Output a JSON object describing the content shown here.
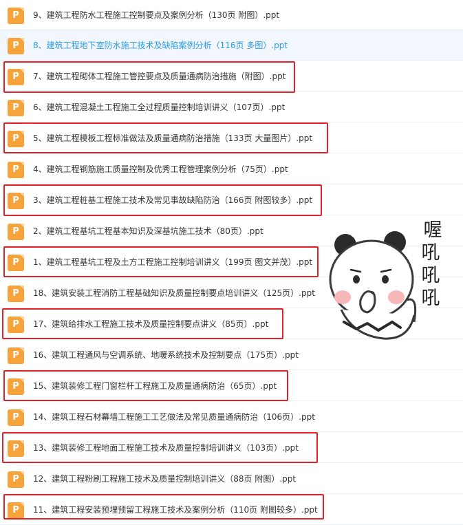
{
  "files": [
    {
      "name": "9、建筑工程防水工程施工控制要点及案例分析（130页 附图）.ppt",
      "icon": "P",
      "highlighted": false,
      "active": false
    },
    {
      "name": "8、建筑工程地下室防水施工技术及缺陷案例分析（116页 多图）.ppt",
      "icon": "P",
      "highlighted": false,
      "active": true
    },
    {
      "name": "7、建筑工程砌体工程施工管控要点及质量通病防治措施（附图）.ppt",
      "icon": "P",
      "highlighted": true,
      "active": false
    },
    {
      "name": "6、建筑工程混凝土工程施工全过程质量控制培训讲义（107页）.ppt",
      "icon": "P",
      "highlighted": false,
      "active": false
    },
    {
      "name": "5、建筑工程模板工程标准做法及质量通病防治措施（133页 大量图片）.ppt",
      "icon": "P",
      "highlighted": true,
      "active": false
    },
    {
      "name": "4、建筑工程钢筋施工质量控制及优秀工程管理案例分析（75页）.ppt",
      "icon": "P",
      "highlighted": false,
      "active": false
    },
    {
      "name": "3、建筑工程桩基工程施工技术及常见事故缺陷防治（166页 附图较多）.ppt",
      "icon": "P",
      "highlighted": true,
      "active": false
    },
    {
      "name": "2、建筑工程基坑工程基本知识及深基坑施工技术（80页）.ppt",
      "icon": "P",
      "highlighted": false,
      "active": false
    },
    {
      "name": "1、建筑工程基坑工程及土方工程施工控制培训讲义（199页 图文并茂）.ppt",
      "icon": "P",
      "highlighted": true,
      "active": false
    },
    {
      "name": "18、建筑安装工程消防工程基础知识及质量控制要点培训讲义（125页）.ppt",
      "icon": "P",
      "highlighted": false,
      "active": false
    },
    {
      "name": "17、建筑给排水工程施工技术及质量控制要点讲义（85页）.ppt",
      "icon": "P",
      "highlighted": true,
      "active": false
    },
    {
      "name": "16、建筑工程通风与空调系统、地暖系统技术及控制要点（175页）.ppt",
      "icon": "P",
      "highlighted": false,
      "active": false
    },
    {
      "name": "15、建筑装修工程门窗栏杆工程施工及质量通病防治（65页）.ppt",
      "icon": "P",
      "highlighted": true,
      "active": false
    },
    {
      "name": "14、建筑工程石材幕墙工程施工工艺做法及常见质量通病防治（106页）.ppt",
      "icon": "P",
      "highlighted": false,
      "active": false
    },
    {
      "name": "13、建筑装修工程地面工程施工技术及质量控制培训讲义（103页）.ppt",
      "icon": "P",
      "highlighted": true,
      "active": false
    },
    {
      "name": "12、建筑工程粉刷工程施工技术及质量控制培训讲义（88页 附图）.ppt",
      "icon": "P",
      "highlighted": false,
      "active": false
    },
    {
      "name": "11、建筑工程安装预埋预留工程施工技术及案例分析（110页 附图较多）.ppt",
      "icon": "P",
      "highlighted": true,
      "active": false
    }
  ],
  "sticker": {
    "text": [
      "喔",
      "吼",
      "吼",
      "吼"
    ]
  },
  "colors": {
    "icon": "#f5a33a",
    "highlight_border": "#e0212a",
    "active_text": "#2b9be6",
    "active_bg": "#f2f7fd"
  }
}
